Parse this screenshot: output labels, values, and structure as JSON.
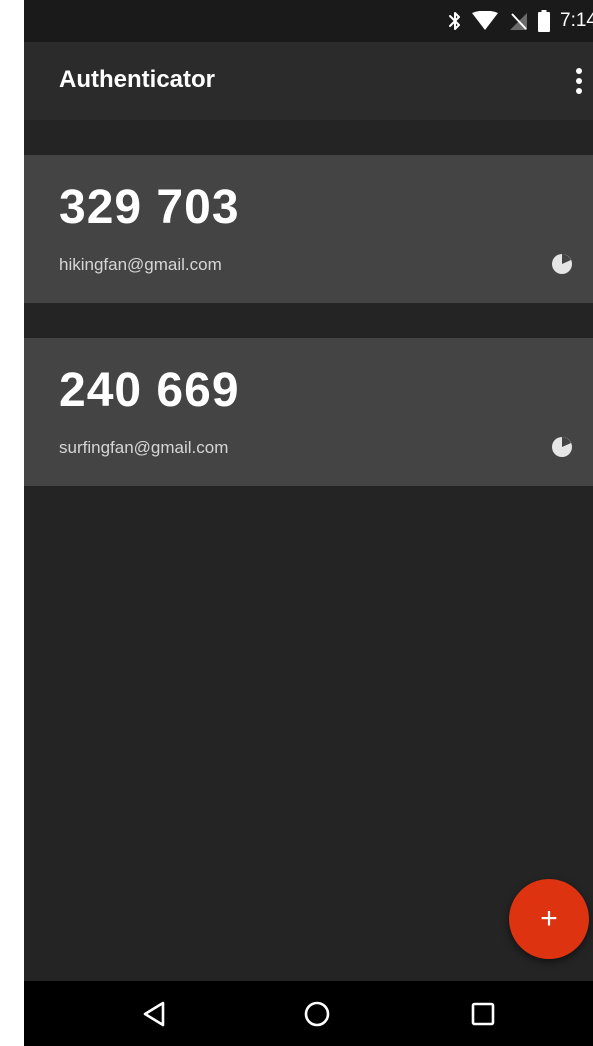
{
  "status_bar": {
    "time": "7:14",
    "icons": [
      "bluetooth-icon",
      "wifi-icon",
      "no-sim-icon",
      "battery-icon"
    ]
  },
  "app_bar": {
    "title": "Authenticator",
    "menu_icon": "more-vert-icon"
  },
  "accounts": [
    {
      "code": "329 703",
      "email": "hikingfan@gmail.com",
      "timer_icon": "countdown-timer-icon"
    },
    {
      "code": "240 669",
      "email": "surfingfan@gmail.com",
      "timer_icon": "countdown-timer-icon"
    }
  ],
  "fab": {
    "label": "+",
    "icon": "add-icon"
  },
  "nav_bar": {
    "icons": [
      "back-icon",
      "home-icon",
      "recents-icon"
    ]
  },
  "colors": {
    "background": "#242424",
    "app_bar": "#2b2b2b",
    "card": "#444444",
    "fab": "#dd3311",
    "nav_bar": "#000000"
  }
}
